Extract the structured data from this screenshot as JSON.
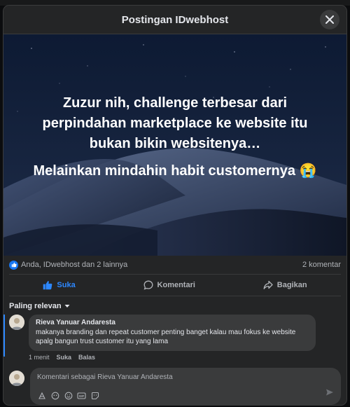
{
  "header": {
    "title": "Postingan IDwebhost"
  },
  "image": {
    "line1": "Zuzur nih, challenge terbesar dari perpindahan marketplace ke website itu bukan bikin websitenya…",
    "line2": "Melainkan mindahin habit customernya 😭"
  },
  "reactions": {
    "summary": "Anda, IDwebhost dan 2 lainnya",
    "comment_count": "2 komentar"
  },
  "actions": {
    "like": "Suka",
    "comment": "Komentari",
    "share": "Bagikan"
  },
  "sort": {
    "label": "Paling relevan"
  },
  "comment": {
    "author": "Rieva Yanuar Andaresta",
    "text": "makanya branding dan repeat customer penting banget kalau mau fokus ke website apalg bangun trust customer itu yang lama",
    "time": "1 menit",
    "like": "Suka",
    "reply": "Balas"
  },
  "composer": {
    "placeholder": "Komentari sebagai Rieva Yanuar Andaresta"
  },
  "colors": {
    "accent": "#2d88ff",
    "background": "#242526",
    "bubble": "#3a3b3c"
  },
  "icons": [
    "close-icon",
    "like-icon",
    "comment-icon",
    "share-icon",
    "sticker-icon",
    "avatar-icon",
    "emoji-icon",
    "gif-icon",
    "sticker-face-icon",
    "send-icon"
  ]
}
